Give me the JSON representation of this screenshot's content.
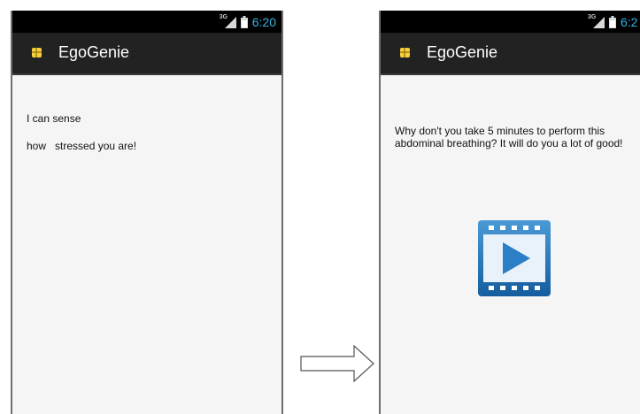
{
  "left_screen": {
    "status_network": "3G",
    "status_time": "6:20",
    "app_title": "EgoGenie",
    "line1": "I can sense",
    "line2": "how   stressed you are!"
  },
  "right_screen": {
    "status_network": "3G",
    "status_time": "6:2",
    "app_title": "EgoGenie",
    "message": "Why don't you take 5 minutes to perform this abdominal breathing? It will do you a lot of good!"
  },
  "icons": {
    "status": [
      "signal-3g-icon",
      "battery-icon"
    ],
    "app": "egogenie-app-icon",
    "media": "video-play-icon",
    "flow": "right-arrow-icon"
  },
  "colors": {
    "status_bar": "#000000",
    "action_bar": "#222222",
    "clock": "#33b5e5",
    "app_icon": "#f6d03a",
    "video_icon": "#1f6fb4",
    "screen_background": "#f5f5f5"
  }
}
